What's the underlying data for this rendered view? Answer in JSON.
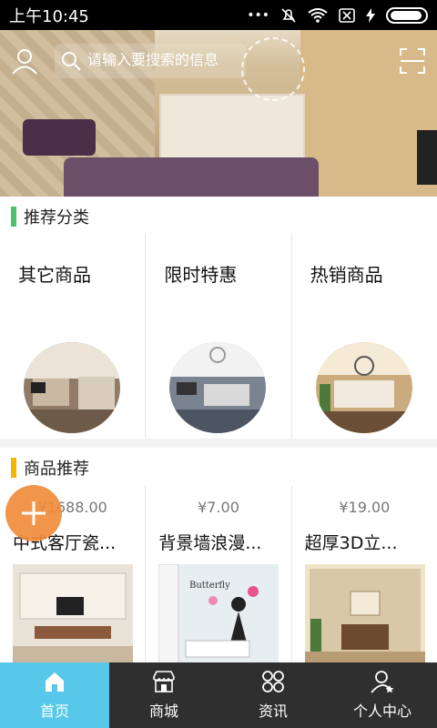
{
  "status_bar": {
    "time": "上午10:45",
    "icons": [
      "more-dots-icon",
      "mute-bell-icon",
      "wifi-icon",
      "sim-off-icon",
      "charging-icon",
      "battery-icon"
    ]
  },
  "header": {
    "search_placeholder": "请输入要搜索的信息",
    "left_icon": "user-icon",
    "right_icon": "scan-icon"
  },
  "sections": {
    "categories": {
      "title": "推荐分类",
      "accent": "#4cc26a"
    },
    "products": {
      "title": "商品推荐",
      "accent": "#f2b705"
    }
  },
  "categories": [
    {
      "label": "其它商品"
    },
    {
      "label": "限时特惠"
    },
    {
      "label": "热销商品"
    }
  ],
  "products": [
    {
      "price": "¥1688.00",
      "name": "中式客厅瓷..."
    },
    {
      "price": "¥7.00",
      "name": "背景墙浪漫..."
    },
    {
      "price": "¥19.00",
      "name": "超厚3D立..."
    }
  ],
  "fab": {
    "icon": "plus-icon",
    "color": "#f08c3c"
  },
  "bottom_nav": [
    {
      "label": "首页",
      "icon": "home-icon",
      "active": true
    },
    {
      "label": "商城",
      "icon": "store-icon",
      "active": false
    },
    {
      "label": "资讯",
      "icon": "grid-icon",
      "active": false
    },
    {
      "label": "个人中心",
      "icon": "user-star-icon",
      "active": false
    }
  ],
  "colors": {
    "nav_active": "#57c8ea",
    "nav_bg": "#2f2f2f"
  }
}
